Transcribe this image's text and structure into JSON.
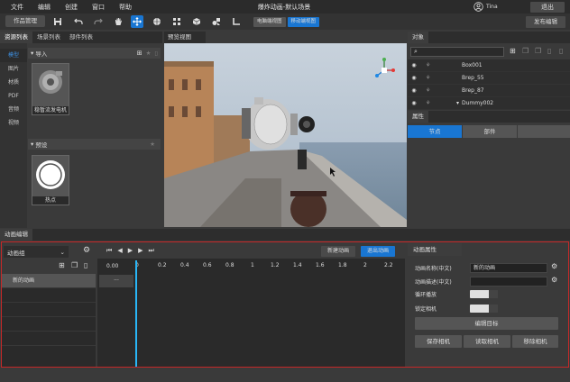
{
  "menu": [
    "文件",
    "编辑",
    "创建",
    "窗口",
    "帮助"
  ],
  "title": "爆炸动画-默认场景",
  "user": "Tina",
  "exit": "退出",
  "toolbar": {
    "manage": "作品管理",
    "view_switch": [
      "电脑端视图",
      "移动端视图"
    ],
    "publish": "发布编辑"
  },
  "left_panel": {
    "tabs": [
      "资源列表",
      "场景列表",
      "部件列表"
    ],
    "categories": [
      "模型",
      "图片",
      "材质",
      "PDF",
      "音频",
      "视频"
    ],
    "import_label": "导入",
    "import_item": "稳暂流发电机",
    "preset_label": "预设",
    "preset_item": "热点"
  },
  "viewport_tab": "预览视图",
  "objects": {
    "tab": "对象",
    "rows": [
      "Box001",
      "Brep_55",
      "Brep_87",
      "Dummy002"
    ]
  },
  "attributes": {
    "tab": "属性",
    "subtabs": [
      "节点",
      "部件",
      ""
    ]
  },
  "anim": {
    "tab": "动画编辑",
    "group": "动画组",
    "list": [
      "新的动画"
    ],
    "time": "0.00",
    "dots": "···",
    "new_btn": "新建动画",
    "exit_btn": "退出动画",
    "ruler": [
      "0",
      "0.2",
      "0.4",
      "0.6",
      "0.8",
      "1",
      "1.2",
      "1.4",
      "1.6",
      "1.8",
      "2",
      "2.2"
    ],
    "props_tab": "动画属性",
    "name_label": "动画名称(中文)",
    "name_value": "新的动画",
    "desc_label": "动画描述(中文)",
    "desc_value": "",
    "loop_label": "循环播放",
    "lock_label": "锁定相机",
    "edit_target": "编辑目标",
    "save_cam": "保存相机",
    "read_cam": "读取相机",
    "remove_cam": "移除相机"
  },
  "colors": {
    "accent": "#1976d2",
    "frame": "#c62828"
  }
}
